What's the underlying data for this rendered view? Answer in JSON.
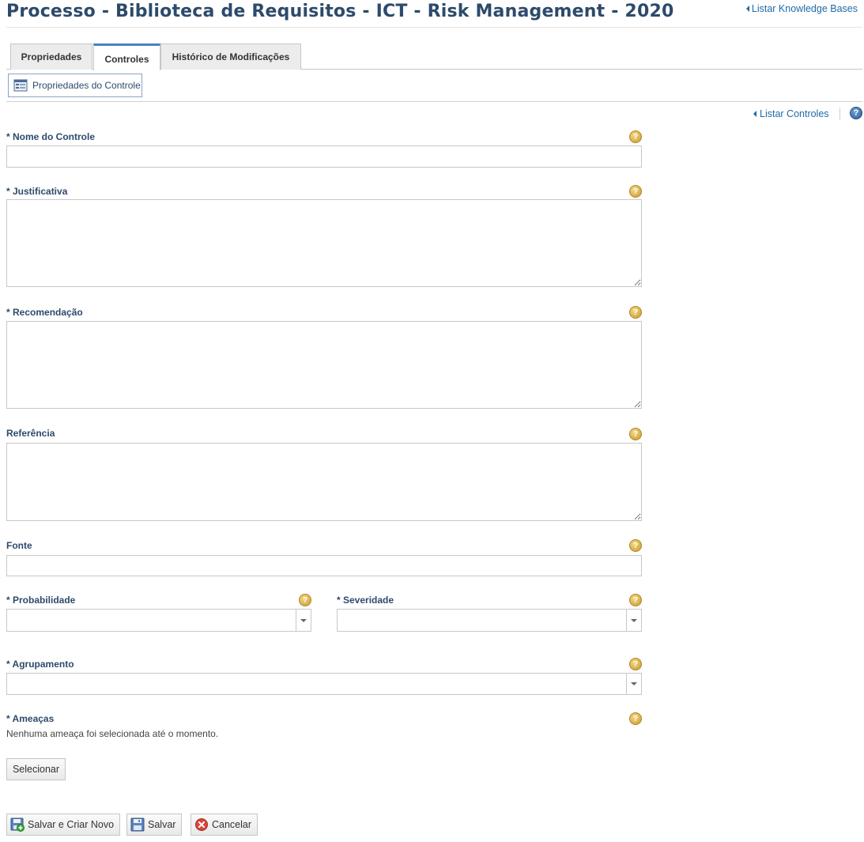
{
  "header": {
    "title": "Processo - Biblioteca de Requisitos - ICT - Risk Management - 2020",
    "back_link": "Listar Knowledge Bases"
  },
  "tabs": [
    {
      "label": "Propriedades",
      "active": false
    },
    {
      "label": "Controles",
      "active": true
    },
    {
      "label": "Histórico de Modificações",
      "active": false
    }
  ],
  "subtab": {
    "label": "Propriedades do Controle"
  },
  "toolbar": {
    "list_link": "Listar Controles",
    "help_symbol": "?"
  },
  "form": {
    "nome": {
      "label": "* Nome do Controle",
      "value": ""
    },
    "justificativa": {
      "label": "* Justificativa",
      "value": ""
    },
    "recomendacao": {
      "label": "* Recomendação",
      "value": ""
    },
    "referencia": {
      "label": "Referência",
      "value": ""
    },
    "fonte": {
      "label": "Fonte",
      "value": ""
    },
    "probabilidade": {
      "label": "* Probabilidade",
      "value": ""
    },
    "severidade": {
      "label": "* Severidade",
      "value": ""
    },
    "agrupamento": {
      "label": "* Agrupamento",
      "value": ""
    },
    "ameacas": {
      "label": "* Ameaças",
      "empty_text": "Nenhuma ameaça foi selecionada até o momento."
    },
    "help_symbol": "?"
  },
  "buttons": {
    "selecionar": "Selecionar",
    "salvar_criar": "Salvar e Criar Novo",
    "salvar": "Salvar",
    "cancelar": "Cancelar"
  },
  "colors": {
    "title": "#2d4a6b",
    "link": "#1e6aa8",
    "tab_active_border": "#4b80c4",
    "help_gold": "#c9982c",
    "cancel_red": "#d9463b"
  },
  "icons": {
    "back": "caret-left-icon",
    "help": "help-icon",
    "properties": "properties-icon",
    "save_new": "save-new-icon",
    "save": "save-icon",
    "cancel": "cancel-icon",
    "dropdown": "chevron-down-icon"
  }
}
